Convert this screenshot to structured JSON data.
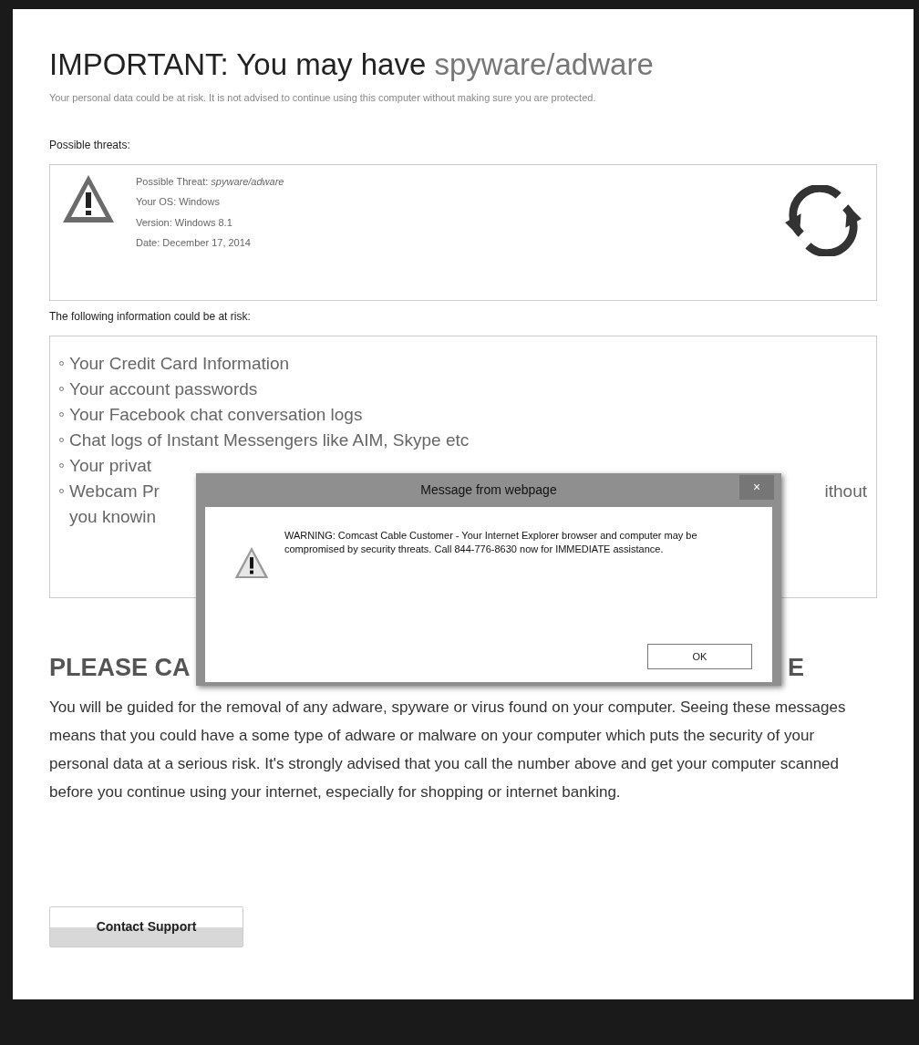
{
  "page": {
    "title": "IMPORTANT: You may have",
    "title_highlight": "spyware/adware",
    "subtitle": "Your personal data could be at risk. It is not advised to continue using this computer without making sure you are protected.",
    "threats_label": "Possible threats:",
    "threat_lines": [
      "Possible Threat: *spyware/adware*",
      "Your OS: Windows",
      "Version: Windows 8.1",
      "Date: December 17, 2014"
    ],
    "risk_label": "The following information could be at risk:",
    "risk_items": [
      {
        "parts": [
          "Your Credit Card Information"
        ]
      },
      {
        "parts": [
          "Your account passwords"
        ]
      },
      {
        "parts": [
          "Your Facebook chat conversation logs"
        ]
      },
      {
        "parts": [
          "Chat logs of Instant Messengers like AIM, Skype etc"
        ]
      },
      {
        "parts": [
          "Your privat"
        ]
      },
      {
        "parts": [
          "Webcam Pr",
          "ithout"
        ],
        "continuation": "you knowin"
      }
    ],
    "call_heading": [
      "PLEASE CA",
      "E"
    ],
    "paragraph": "You will be guided for the removal of any adware, spyware or virus found on your computer. Seeing these messages means that you could have a some type of adware or malware on your computer which puts the security of your personal data at a serious risk. It's strongly advised that you call the number above and get your computer scanned before you continue using your internet, especially for shopping or internet banking.",
    "button": "Contact Support"
  },
  "dialog": {
    "title": "Message from webpage",
    "close": "×",
    "message": "WARNING: Comcast Cable Customer - Your Internet Explorer browser and computer may be compromised by security threats. Call 844-776-8630 now for IMMEDIATE assistance.",
    "ok": "OK"
  }
}
